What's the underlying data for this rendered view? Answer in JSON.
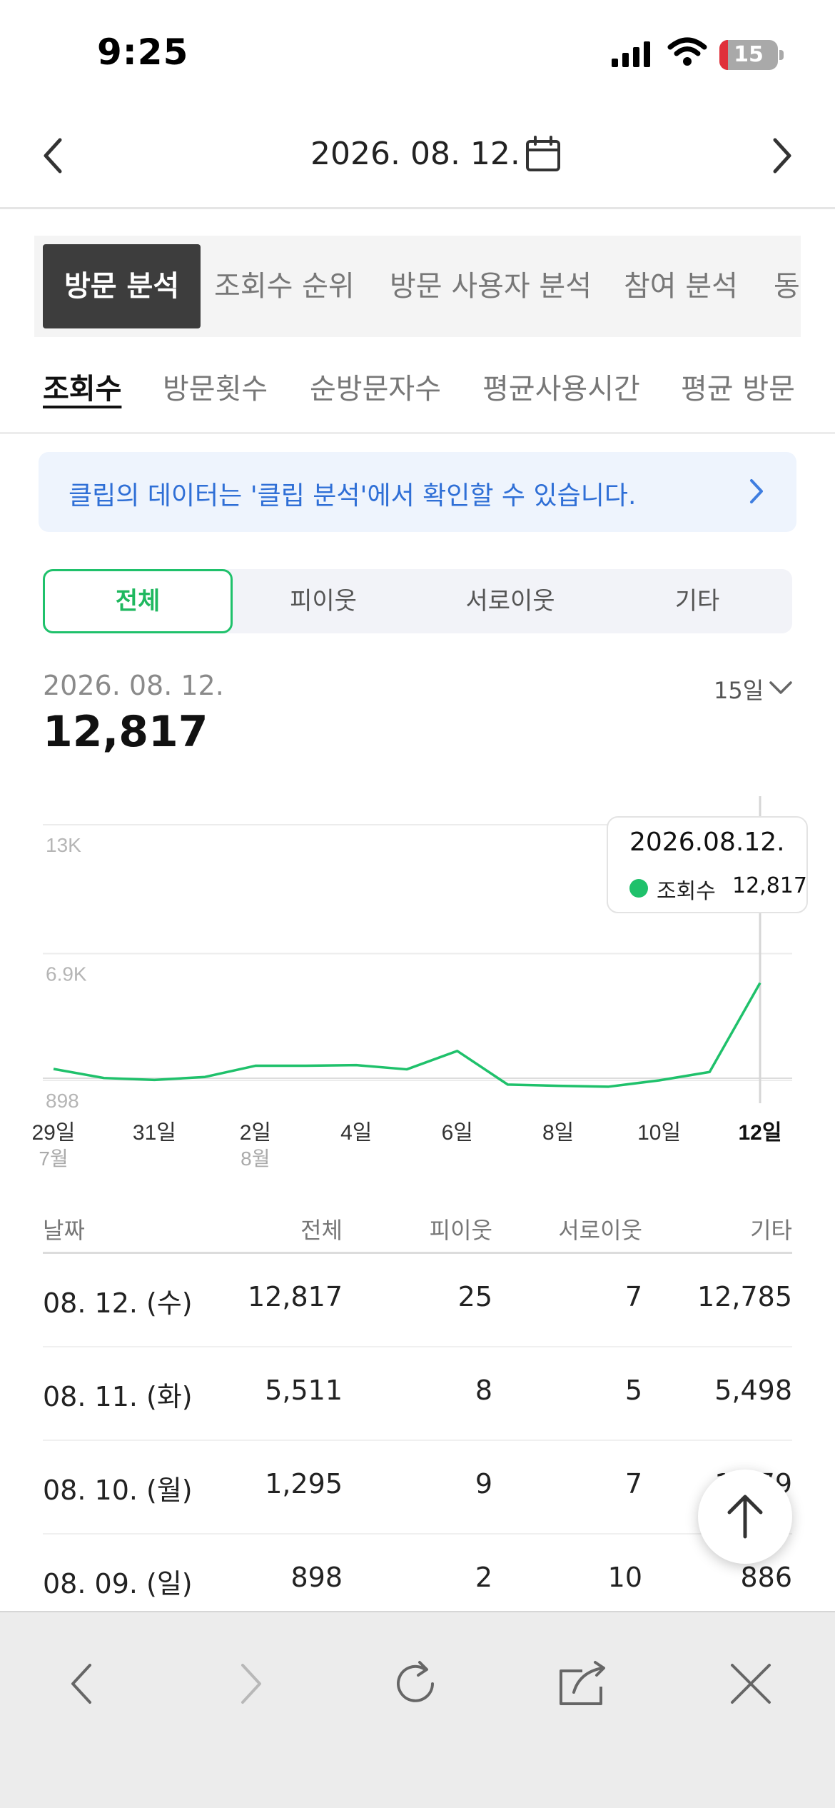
{
  "status_bar": {
    "time": "9:25",
    "battery": "15",
    "battery_level": 0.15
  },
  "header": {
    "date": "2026. 08. 12."
  },
  "main_tabs": [
    {
      "label": "방문 분석",
      "active": true
    },
    {
      "label": "조회수 순위",
      "active": false
    },
    {
      "label": "방문 사용자 분석",
      "active": false
    },
    {
      "label": "참여 분석",
      "active": false
    },
    {
      "label": "동",
      "active": false
    }
  ],
  "sub_tabs": [
    {
      "label": "조회수",
      "active": true
    },
    {
      "label": "방문횟수",
      "active": false
    },
    {
      "label": "순방문자수",
      "active": false
    },
    {
      "label": "평균사용시간",
      "active": false
    },
    {
      "label": "평균 방문",
      "active": false
    }
  ],
  "banner": {
    "text": "클립의 데이터는 '클립 분석'에서 확인할 수 있습니다."
  },
  "segments": [
    {
      "label": "전체",
      "active": true
    },
    {
      "label": "피이웃",
      "active": false
    },
    {
      "label": "서로이웃",
      "active": false
    },
    {
      "label": "기타",
      "active": false
    }
  ],
  "summary": {
    "date": "2026. 08. 12.",
    "total": "12,817",
    "range": "15일"
  },
  "chart_data": {
    "type": "line",
    "series": [
      {
        "name": "조회수",
        "values": [
          1440,
          1010,
          920,
          1060,
          1590,
          1590,
          1620,
          1420,
          2290,
          700,
          640,
          600,
          898,
          1295,
          5511,
          12817
        ]
      }
    ],
    "x": [
      "7/29",
      "7/30",
      "7/31",
      "8/1",
      "8/2",
      "8/3",
      "8/4",
      "8/5",
      "8/6",
      "8/7",
      "8/8",
      "8/9",
      "8/10",
      "8/11",
      "8/12"
    ],
    "x_index": [
      0,
      1,
      2,
      3,
      4,
      5,
      6,
      7,
      8,
      9,
      10,
      11,
      12,
      13,
      14
    ],
    "y_ticks": [
      "13K",
      "6.9K",
      "898"
    ],
    "y_tick_values": [
      13000,
      6900,
      898
    ],
    "x_tick_labels": [
      {
        "label": "29일",
        "sub": "7월",
        "bold": false
      },
      {
        "label": "31일",
        "sub": "",
        "bold": false
      },
      {
        "label": "2일",
        "sub": "8월",
        "bold": false
      },
      {
        "label": "4일",
        "sub": "",
        "bold": false
      },
      {
        "label": "6일",
        "sub": "",
        "bold": false
      },
      {
        "label": "8일",
        "sub": "",
        "bold": false
      },
      {
        "label": "10일",
        "sub": "",
        "bold": false
      },
      {
        "label": "12일",
        "sub": "",
        "bold": true
      }
    ],
    "color": "#1fc16b",
    "grid": true
  },
  "tooltip": {
    "date": "2026.08.12.",
    "label": "조회수",
    "value": "12,817"
  },
  "table": {
    "headers": [
      "날짜",
      "전체",
      "피이웃",
      "서로이웃",
      "기타"
    ],
    "rows": [
      [
        "08. 12. (수)",
        "12,817",
        "25",
        "7",
        "12,785"
      ],
      [
        "08. 11. (화)",
        "5,511",
        "8",
        "5",
        "5,498"
      ],
      [
        "08. 10. (월)",
        "1,295",
        "9",
        "7",
        "1,279"
      ],
      [
        "08. 09. (일)",
        "898",
        "2",
        "10",
        "886"
      ]
    ]
  }
}
